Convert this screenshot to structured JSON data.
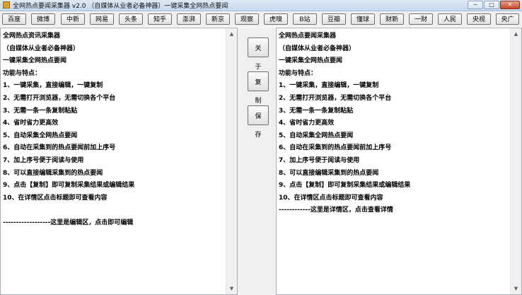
{
  "window": {
    "title": "全网热点要闻采集器  v2.0  （自媒体从业者必备神器）一键采集全网热点要闻",
    "minimize": "─",
    "restore": "□",
    "close": "✕"
  },
  "toolbar": [
    "百度",
    "微博",
    "中新",
    "网易",
    "头条",
    "知乎",
    "澎湃",
    "新京",
    "观察",
    "虎嗅",
    "B站",
    "豆瓣",
    "懂球",
    "财新",
    "一财",
    "人民",
    "央视",
    "央广"
  ],
  "left_pane": {
    "lines": [
      "全网热点资讯采集器",
      "（自媒体从业者必备神器）",
      "一键采集全网热点要闻",
      "功能与特点：",
      "1、一键采集，直接编辑，一键复制",
      "2、无需打开浏览器，无需切换各个平台",
      "3、无需一条一条复制粘贴",
      "4、省时省力更高效",
      "5、自动采集全网热点要闻",
      "6、自动在采集到的热点要闻前加上序号",
      "7、加上序号便于阅读与使用",
      "8、可以直接编辑采集到的热点要闻",
      "9、点击【复制】即可复制采集结果或编辑结果",
      "10、在详情区点击标题即可查看内容",
      "",
      "------------------这里是编辑区，点击即可编辑"
    ]
  },
  "middle": {
    "about": "关于",
    "copy": "复制",
    "save": "保存"
  },
  "right_pane": {
    "lines": [
      "全网热点要闻采集器",
      "（自媒体从业者必备神器）",
      "一键采集全网热点要闻",
      "功能与特点：",
      "1、一键采集，直接编辑，一键复制",
      "2、无需打开浏览器，无需切换各个平台",
      "3、无需一条一条复制粘贴",
      "4、省时省力更高效",
      "5、自动采集全网热点要闻",
      "6、自动在采集到的热点要闻前加上序号",
      "7、加上序号便于阅读与使用",
      "8、可以直接编辑采集到的热点要闻",
      "9、点击【复制】即可复制采集结果或编辑结果",
      "10、在详情区点击标题即可查看内容",
      "------------这里是详情区，点击查看详情"
    ]
  },
  "scroll_icons": {
    "up": "▲",
    "down": "▼"
  }
}
